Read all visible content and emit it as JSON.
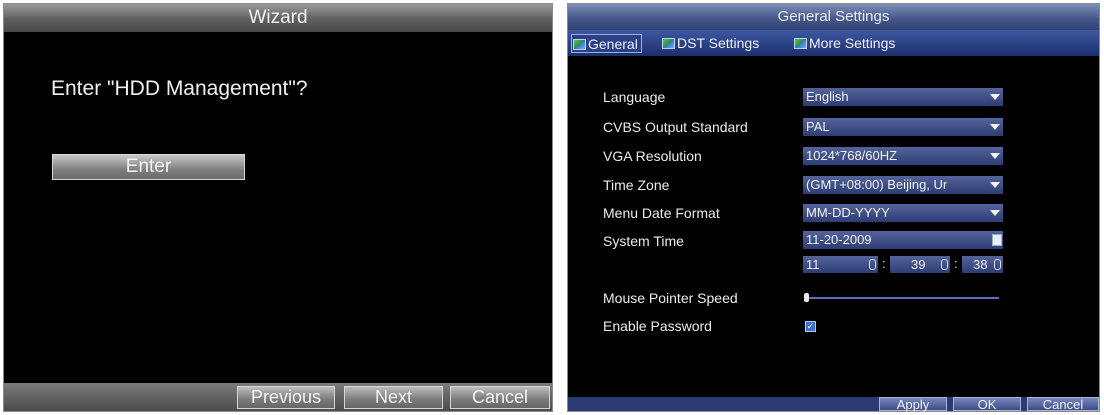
{
  "wizard": {
    "title": "Wizard",
    "question": "Enter \"HDD Management\"?",
    "enter_label": "Enter",
    "footer": {
      "previous_label": "Previous",
      "next_label": "Next",
      "cancel_label": "Cancel"
    }
  },
  "settings": {
    "title": "General Settings",
    "tabs": [
      {
        "label": "General",
        "icon": "tab-icon",
        "active": true
      },
      {
        "label": "DST Settings",
        "icon": "tab-icon",
        "active": false
      },
      {
        "label": "More Settings",
        "icon": "tab-icon",
        "active": false
      }
    ],
    "fields": {
      "language": {
        "label": "Language",
        "value": "English"
      },
      "cvbs": {
        "label": "CVBS Output Standard",
        "value": "PAL"
      },
      "vga": {
        "label": "VGA Resolution",
        "value": "1024*768/60HZ"
      },
      "timezone": {
        "label": "Time Zone",
        "value": "(GMT+08:00) Beijing, Ur"
      },
      "date_format": {
        "label": "Menu Date Format",
        "value": "MM-DD-YYYY"
      },
      "system_time": {
        "label": "System Time",
        "date": "11-20-2009",
        "hour": "11",
        "minute": "39",
        "second": "38",
        "separator": ":"
      },
      "mouse_speed": {
        "label": "Mouse Pointer Speed",
        "level": 0.0
      },
      "enable_password": {
        "label": "Enable Password",
        "checked": true
      }
    },
    "footer": {
      "apply_label": "Apply",
      "ok_label": "OK",
      "cancel_label": "Cancel"
    }
  },
  "colors": {
    "settings_accent": "#2d3d75",
    "wizard_titlebar": "#5f5f5f"
  }
}
